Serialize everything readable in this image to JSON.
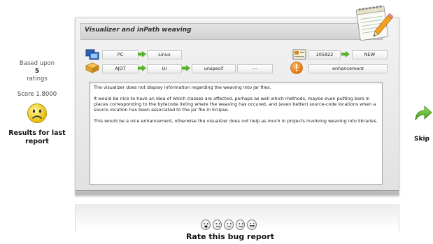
{
  "stats": {
    "based_upon": "Based upon",
    "count": "5",
    "ratings": "ratings",
    "score": "Score 1.8000",
    "results": "Results for last report"
  },
  "bug": {
    "title": "Visualizer and inPath weaving",
    "platform": "PC",
    "os": "Linux",
    "product": "AJDT",
    "component": "UI",
    "version": "unspecif",
    "extra": "---",
    "id": "105822",
    "status": "NEW",
    "severity": "enhancement",
    "description": [
      "The visualizer does not display information regarding the weaving into jar files.",
      "It would be nice to have an idea of which classes are affected, perhaps as well which methods, maybe even putting bars in places corresponding to the bytecode listing where the weaving has occured, and (even better) source-code locations when a source location has been associated to the jar file in Eclipse.",
      "This would be a nice enhancement, otherwise the visualizer does not help as much in projects involving weaving into libraries."
    ]
  },
  "actions": {
    "skip": "Skip",
    "rate": "Rate this bug report"
  },
  "icons": {
    "left_face": "sad-face-icon",
    "skip": "green-forward-arrow-icon",
    "notepad": "notepad-pencil-icon",
    "severity": "warning-exclamation-icon"
  },
  "colors": {
    "arrow": "#55b02a",
    "smiley": "#f2d33a",
    "warning": "#f08a12"
  }
}
